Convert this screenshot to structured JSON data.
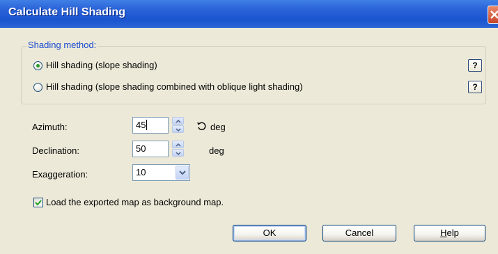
{
  "window": {
    "title": "Calculate Hill Shading"
  },
  "shading_method": {
    "group_label": "Shading method:",
    "options": [
      {
        "label": "Hill shading (slope shading)",
        "selected": true
      },
      {
        "label": "Hill shading (slope shading combined with oblique light shading)",
        "selected": false
      }
    ],
    "help_label": "?"
  },
  "fields": {
    "azimuth": {
      "label": "Azimuth:",
      "value": "45",
      "unit": "deg",
      "unit_icon": "rotate-ccw-icon"
    },
    "declination": {
      "label": "Declination:",
      "value": "50",
      "unit": "deg"
    },
    "exaggeration": {
      "label": "Exaggeration:",
      "value": "10"
    }
  },
  "load_background": {
    "label": "Load the exported map as background map.",
    "checked": true
  },
  "buttons": {
    "ok": "OK",
    "cancel": "Cancel",
    "help_first": "H",
    "help_rest": "elp"
  },
  "colors": {
    "titlebar": "#2a62d8",
    "dialog_bg": "#ece9d8",
    "group_label": "#1a4bd0",
    "radio_dot": "#2b9a2b",
    "close_button": "#c8462a"
  }
}
